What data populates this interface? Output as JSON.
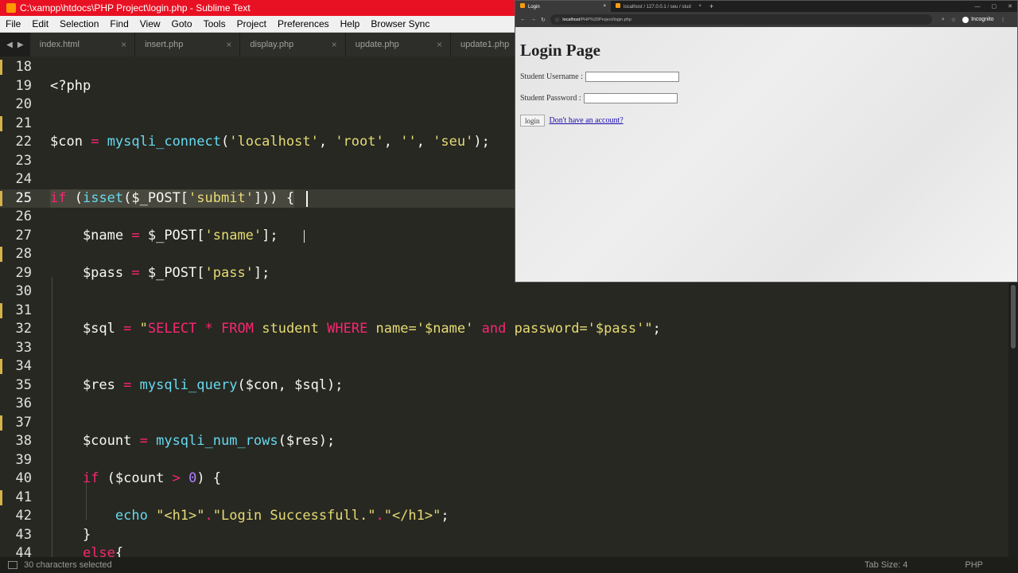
{
  "window": {
    "title": "C:\\xampp\\htdocs\\PHP Project\\login.php - Sublime Text"
  },
  "menu": [
    "File",
    "Edit",
    "Selection",
    "Find",
    "View",
    "Goto",
    "Tools",
    "Project",
    "Preferences",
    "Help",
    "Browser Sync"
  ],
  "tabs": [
    {
      "label": "index.html"
    },
    {
      "label": "insert.php"
    },
    {
      "label": "display.php"
    },
    {
      "label": "update.php"
    },
    {
      "label": "update1.php"
    }
  ],
  "editor": {
    "line_numbers": [
      "18",
      "19",
      "20",
      "21",
      "22",
      "23",
      "24",
      "25",
      "26",
      "27",
      "28",
      "29",
      "30",
      "31",
      "32",
      "33",
      "34",
      "35",
      "36",
      "37",
      "38",
      "39",
      "40",
      "41",
      "42",
      "43",
      "44"
    ],
    "current_line": "25"
  },
  "status": {
    "selection": "30 characters selected",
    "tab_size": "Tab Size: 4",
    "syntax": "PHP"
  },
  "browser": {
    "tabs": [
      {
        "label": "Login",
        "active": true
      },
      {
        "label": "localhost / 127.0.0.1 / seu / stud",
        "active": false
      }
    ],
    "address": {
      "host": "localhost",
      "path": "/PHP%20Project/login.php"
    },
    "profile": "Incognito",
    "page": {
      "heading": "Login Page",
      "username_label": "Student Username :",
      "password_label": "Student Password :",
      "login_button": "login",
      "signup_link": "Don't have an account?"
    }
  }
}
